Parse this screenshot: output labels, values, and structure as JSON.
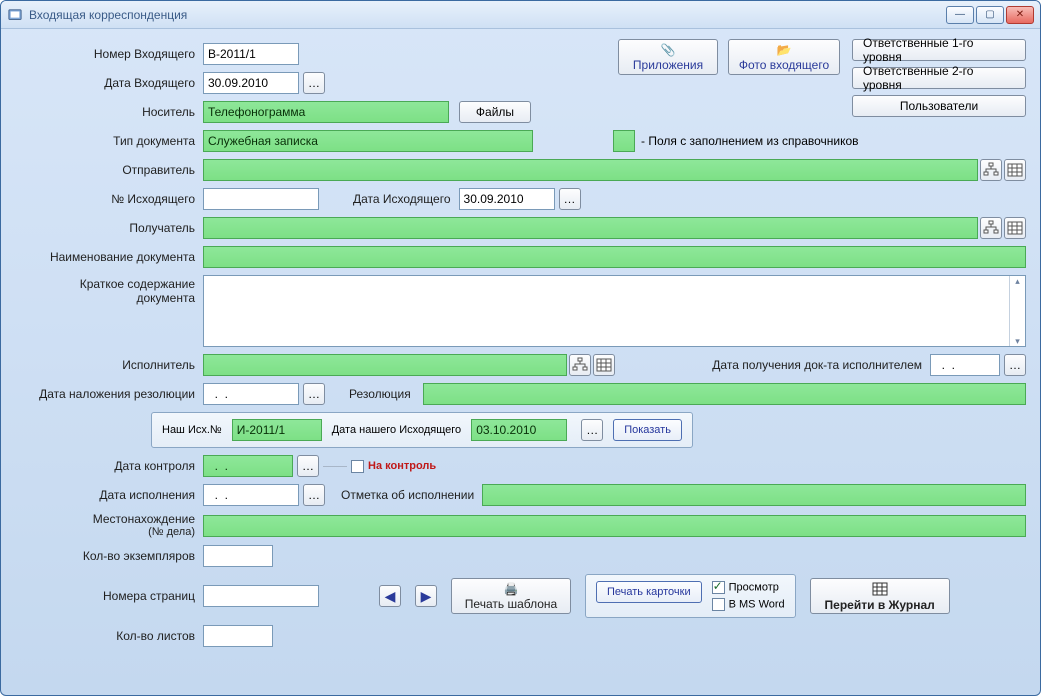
{
  "window": {
    "title": "Входящая корреспонденция"
  },
  "top_right": {
    "attachments": "Приложения",
    "photo_incoming": "Фото входящего",
    "responsible1": "Ответственные 1-го уровня",
    "responsible2": "Ответственные 2-го уровня",
    "users": "Пользователи"
  },
  "legend": "-  Поля с заполнением из справочников",
  "labels": {
    "incoming_no": "Номер Входящего",
    "incoming_date": "Дата Входящего",
    "carrier": "Носитель",
    "files_btn": "Файлы",
    "doc_type": "Тип документа",
    "sender": "Отправитель",
    "outgoing_no": "№ Исходящего",
    "outgoing_date": "Дата Исходящего",
    "recipient": "Получатель",
    "doc_name": "Наименование документа",
    "summary_l1": "Краткое содержание",
    "summary_l2": "документа",
    "executor": "Исполнитель",
    "exec_receive_date": "Дата получения док-та исполнителем",
    "resolution_date": "Дата наложения резолюции",
    "resolution": "Резолюция",
    "our_out_no": "Наш Исх.№",
    "our_out_date": "Дата нашего Исходящего",
    "show": "Показать",
    "control_date": "Дата контроля",
    "on_control": "На контроль",
    "exec_date": "Дата исполнения",
    "exec_mark": "Отметка об исполнении",
    "location_l1": "Местонахождение",
    "location_l2": "(№ дела)",
    "copies": "Кол-во экземпляров",
    "pages": "Номера страниц",
    "sheets": "Кол-во листов"
  },
  "values": {
    "incoming_no": "В-2011/1",
    "incoming_date": "30.09.2010",
    "carrier": "Телефонограмма",
    "doc_type": "Служебная записка",
    "sender": "",
    "outgoing_no": "",
    "outgoing_date": "30.09.2010",
    "recipient": "",
    "doc_name": "",
    "summary": "",
    "executor": "",
    "exec_receive_date": "  .  .",
    "resolution_date": "  .  .",
    "resolution": "",
    "our_out_no": "И-2011/1",
    "our_out_date": "03.10.2010",
    "control_date": "  .  .",
    "on_control_checked": false,
    "exec_date": "  .  .",
    "exec_mark": "",
    "location": "",
    "copies": "",
    "pages": "",
    "sheets": ""
  },
  "footer": {
    "print_template": "Печать шаблона",
    "print_card": "Печать карточки",
    "preview": "Просмотр",
    "preview_checked": true,
    "msword": "В MS Word",
    "msword_checked": false,
    "go_journal": "Перейти в Журнал"
  }
}
